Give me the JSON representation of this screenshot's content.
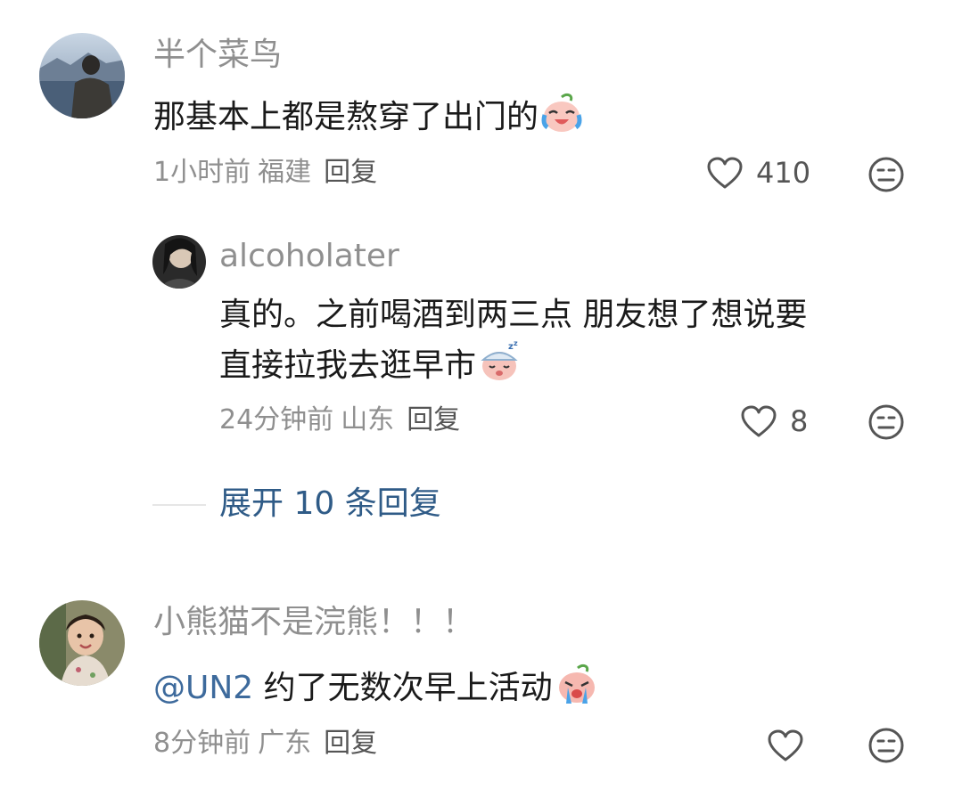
{
  "comments": [
    {
      "username": "半个菜鸟",
      "text": "那基本上都是熬穿了出门的",
      "emoji_icon": "laugh-cry-emoji-icon",
      "time": "1小时前",
      "region": "福建",
      "reply_label": "回复",
      "likes": "410",
      "replies": [
        {
          "username": "alcoholater",
          "text_line1": "真的。之前喝酒到两三点 朋友想了想说要",
          "text_line2": "直接拉我去逛早市",
          "emoji_icon": "sleepy-emoji-icon",
          "time": "24分钟前",
          "region": "山东",
          "reply_label": "回复",
          "likes": "8"
        }
      ],
      "expand_label": "展开 10 条回复"
    },
    {
      "username": "小熊猫不是浣熊！！！",
      "mention": "@UN2",
      "text": " 约了无数次早上活动",
      "emoji_icon": "crying-emoji-icon",
      "time": "8分钟前",
      "region": "广东",
      "reply_label": "回复",
      "likes": ""
    }
  ],
  "colors": {
    "username": "#8f8f8f",
    "text": "#1a1a1a",
    "mention": "#3d6a9c",
    "expand": "#2f5b87"
  }
}
